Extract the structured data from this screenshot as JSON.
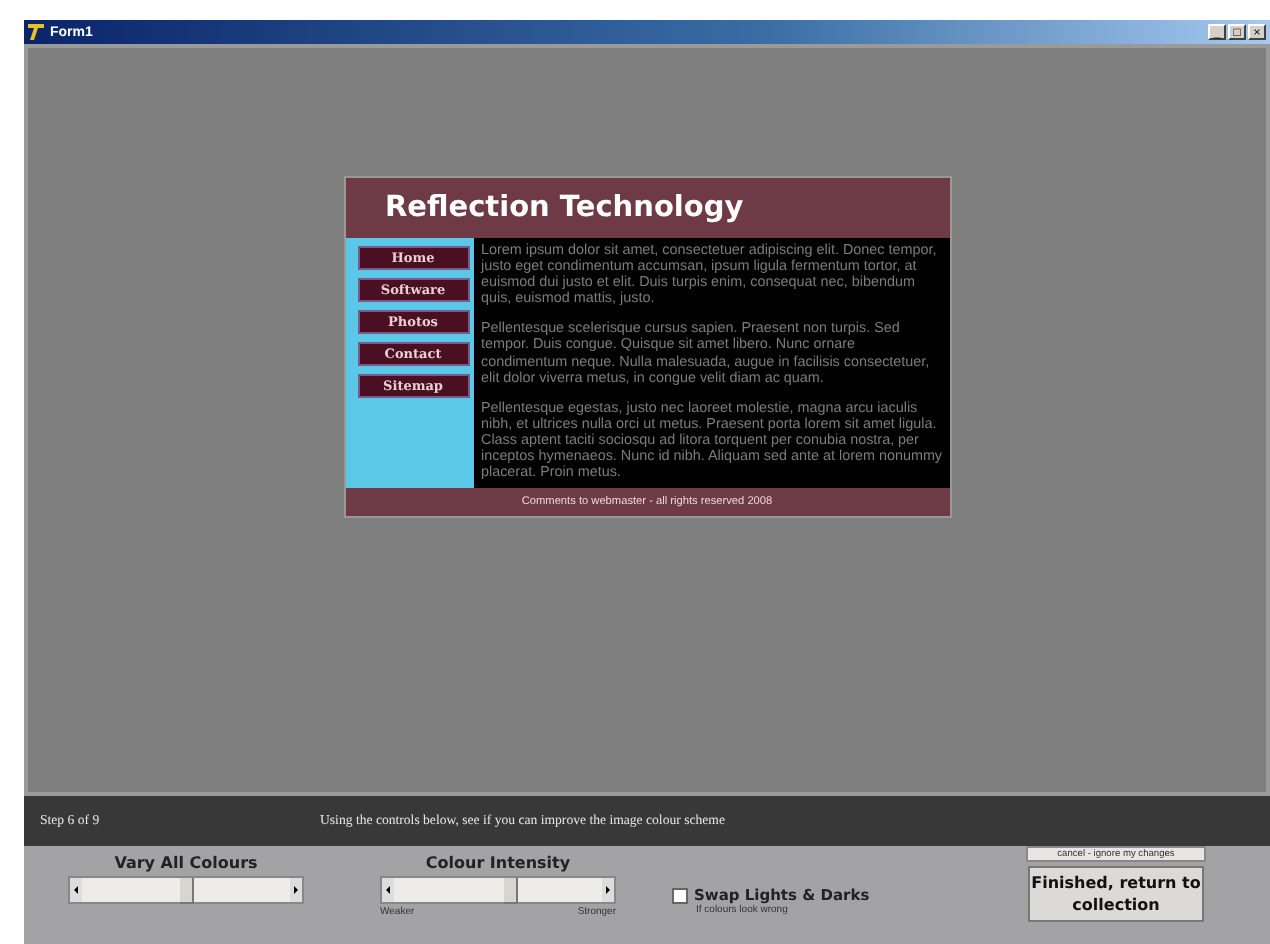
{
  "window": {
    "title": "Form1",
    "buttons": [
      "_",
      "□",
      "×"
    ]
  },
  "preview": {
    "site_title": "Reflection Technology",
    "nav": [
      "Home",
      "Software",
      "Photos",
      "Contact",
      "Sitemap"
    ],
    "paragraphs": [
      "Lorem ipsum dolor sit amet, consectetuer adipiscing elit. Donec tempor, justo eget condimentum accumsan, ipsum ligula fermentum tortor, at euismod dui justo et elit. Duis turpis enim, consequat nec, bibendum quis, euismod mattis, justo.",
      "Pellentesque scelerisque cursus sapien. Praesent non turpis. Sed tempor. Duis congue. Quisque sit amet libero. Nunc ornare condimentum neque. Nulla malesuada, augue in facilisis consectetuer, elit dolor viverra metus, in congue velit diam ac quam.",
      "Pellentesque egestas, justo nec laoreet molestie, magna arcu iaculis nibh, et ultrices nulla orci ut metus. Praesent porta lorem sit amet ligula. Class aptent taciti sociosqu ad litora torquent per conubia nostra, per inceptos hymenaeos. Nunc id nibh. Aliquam sed ante at lorem nonummy placerat. Proin metus."
    ],
    "footer": "Comments to webmaster - all rights reserved 2008"
  },
  "step_bar": {
    "step": "Step 6 of 9",
    "instruction": "Using the controls below, see if you can improve the image colour scheme"
  },
  "controls": {
    "sliders": [
      {
        "label": "Vary All Colours",
        "level": 0.5
      },
      {
        "label": "Colour Intensity",
        "level": 0.55,
        "min_label": "Weaker",
        "max_label": "Stronger"
      }
    ],
    "swap": {
      "label": "Swap Lights & Darks",
      "hint": "If colours look wrong",
      "checked": false
    },
    "cancel_button": "cancel - ignore my changes",
    "finish_button": "Finished, return to collection"
  }
}
